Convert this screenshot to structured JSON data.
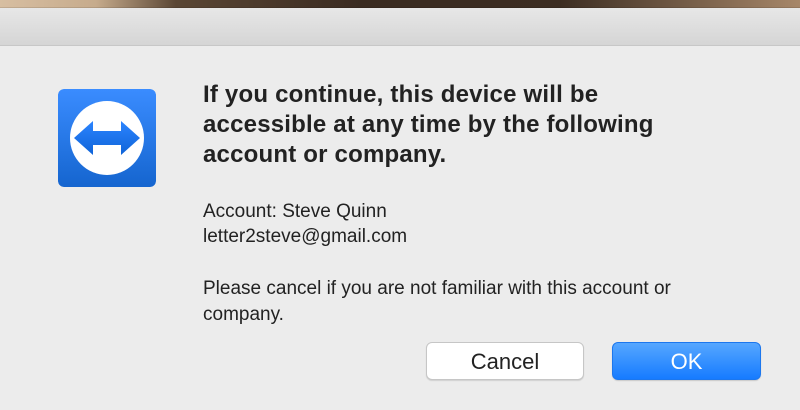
{
  "dialog": {
    "headline": "If you continue, this device will be accessible at any time by the following account or company.",
    "account_label": "Account: Steve Quinn",
    "account_email": "letter2steve@gmail.com",
    "warning": "Please cancel if you are not familiar with this account or company.",
    "cancel_label": "Cancel",
    "ok_label": "OK"
  },
  "icons": {
    "app": "teamviewer-icon"
  },
  "colors": {
    "primary_button": "#167bff",
    "app_icon_blue": "#1f6fd1",
    "dialog_background": "#ececec"
  }
}
